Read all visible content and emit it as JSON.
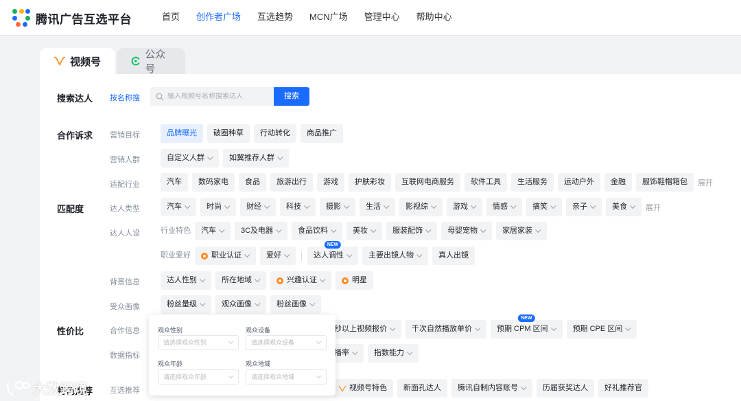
{
  "brand": {
    "name": "腾讯广告互选平台"
  },
  "nav": [
    "首页",
    "创作者广场",
    "互选趋势",
    "MCN广场",
    "管理中心",
    "帮助中心"
  ],
  "tabs": {
    "active": "视频号",
    "inactive": "公众号"
  },
  "search": {
    "label": "搜索达人",
    "mode": "按名称搜",
    "placeholder": "输入视频号名称搜索达人",
    "button": "搜索"
  },
  "sections": {
    "cooperation": "合作诉求",
    "match": "匹配度",
    "value": "性价比",
    "special": "特色推荐"
  },
  "sub": {
    "goal": "营销目标",
    "crowd": "营销人群",
    "industry": "适配行业",
    "type": "达人类型",
    "persona": "达人人设",
    "background": "背景信息",
    "audience": "受众画像",
    "coop_info": "合作信息",
    "metrics": "数据指标",
    "recommend": "互选推荐"
  },
  "goals": [
    "品牌曝光",
    "破圈种草",
    "行动转化",
    "商品推广"
  ],
  "crowds": [
    "自定义人群",
    "如翼推荐人群"
  ],
  "industries": [
    "汽车",
    "数码家电",
    "食品",
    "旅游出行",
    "游戏",
    "护肤彩妆",
    "互联网电商服务",
    "软件工具",
    "生活服务",
    "运动户外",
    "金融",
    "服饰鞋帽箱包"
  ],
  "expand": "展开",
  "types": [
    "汽车",
    "时尚",
    "财经",
    "科技",
    "摄影",
    "生活",
    "影视综",
    "游戏",
    "情感",
    "搞笑",
    "亲子",
    "美食"
  ],
  "persona": {
    "industry_label": "行业特色",
    "industry": [
      "汽车",
      "3C及电器",
      "食品饮料",
      "美妆",
      "服装配饰",
      "母婴宠物",
      "家居家装"
    ],
    "career_label": "职业爱好",
    "career": [
      "职业认证",
      "爱好"
    ],
    "extra": [
      "达人调性",
      "主要出镜人物",
      "真人出镜"
    ],
    "new_badge": "NEW"
  },
  "background": [
    "达人性别",
    "所在地域",
    "兴趣认证",
    "明星"
  ],
  "audience": [
    "粉丝量级",
    "观众画像",
    "粉丝画像"
  ],
  "coop_partial": [
    "秒以上视频报价",
    "千次自然播放单价",
    "预期 CPM 区间",
    "预期 CPE 区间"
  ],
  "metrics_partial": [
    "播率",
    "指数能力"
  ],
  "recommend_partial": [
    "视频号特色",
    "新面孔达人",
    "腾讯自制内容账号",
    "历届获奖达人",
    "好礼推荐官"
  ],
  "popup": {
    "gender_label": "观众性别",
    "gender_ph": "请选择观众性别",
    "device_label": "观众设备",
    "device_ph": "请选择观众设备",
    "age_label": "观众年龄",
    "age_ph": "请选择观众年龄",
    "region_label": "观众地域",
    "region_ph": "请选择观众地域"
  },
  "watermark": "大数跨境"
}
